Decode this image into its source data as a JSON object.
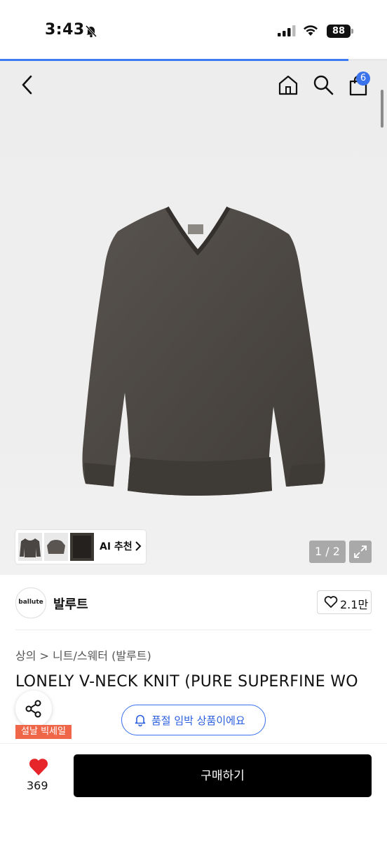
{
  "status_bar": {
    "time": "3:43",
    "battery": "88"
  },
  "header": {
    "cart_count": "6",
    "progress": 0.9
  },
  "gallery": {
    "counter": "1 / 2",
    "ai_label": "AI 추천"
  },
  "brand": {
    "logo_text": "ballute",
    "name": "발루트",
    "likes": "2.1만"
  },
  "breadcrumb": {
    "text": "상의 > 니트/스웨터 (발루트)"
  },
  "product": {
    "title": "LONELY V-NECK KNIT (PURE SUPERFINE WO",
    "sale_tag": "설날 빅세일",
    "soldout_notice": "품절 임박 상품이에요"
  },
  "bottom": {
    "wish_count": "369",
    "buy_label": "구매하기"
  },
  "colors": {
    "accent": "#3a73ec",
    "sale": "#ef6649",
    "buy_bg": "#000000"
  }
}
